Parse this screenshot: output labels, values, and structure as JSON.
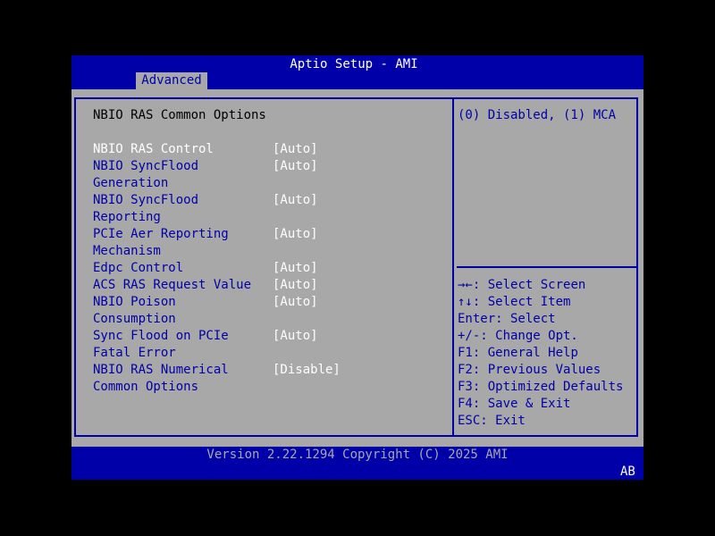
{
  "window": {
    "title": "Aptio Setup - AMI"
  },
  "tabs": [
    {
      "label": "Advanced",
      "selected": true
    }
  ],
  "section": {
    "title": "NBIO RAS Common Options"
  },
  "settings": [
    {
      "label_lines": [
        "NBIO RAS Control"
      ],
      "value": "[Auto]",
      "highlighted": true
    },
    {
      "label_lines": [
        "NBIO SyncFlood",
        "Generation"
      ],
      "value": "[Auto]",
      "highlighted": false
    },
    {
      "label_lines": [
        "NBIO SyncFlood",
        "Reporting"
      ],
      "value": "[Auto]",
      "highlighted": false
    },
    {
      "label_lines": [
        "PCIe Aer Reporting",
        "Mechanism"
      ],
      "value": "[Auto]",
      "highlighted": false
    },
    {
      "label_lines": [
        "Edpc Control"
      ],
      "value": "[Auto]",
      "highlighted": false
    },
    {
      "label_lines": [
        "ACS RAS Request Value"
      ],
      "value": "[Auto]",
      "highlighted": false
    },
    {
      "label_lines": [
        "NBIO Poison",
        "Consumption"
      ],
      "value": "[Auto]",
      "highlighted": false
    },
    {
      "label_lines": [
        "Sync Flood on PCIe",
        "Fatal Error"
      ],
      "value": "[Auto]",
      "highlighted": false
    },
    {
      "label_lines": [
        "NBIO RAS Numerical",
        "Common Options"
      ],
      "value": "[Disable]",
      "highlighted": false
    }
  ],
  "help": {
    "description": "(0) Disabled, (1) MCA"
  },
  "keys": [
    {
      "key": "→←:",
      "action": " Select Screen"
    },
    {
      "key": "↑↓:",
      "action": " Select Item"
    },
    {
      "key": "Enter:",
      "action": " Select"
    },
    {
      "key": "+/-:",
      "action": " Change Opt."
    },
    {
      "key": "F1:",
      "action": " General Help"
    },
    {
      "key": "F2:",
      "action": " Previous Values"
    },
    {
      "key": "F3:",
      "action": " Optimized Defaults"
    },
    {
      "key": "F4:",
      "action": " Save & Exit"
    },
    {
      "key": "ESC:",
      "action": " Exit"
    }
  ],
  "footer": {
    "version": "Version 2.22.1294 Copyright (C) 2025 AMI",
    "corner": "AB"
  },
  "colors": {
    "bios_blue": "#0000a8",
    "bios_gray": "#a8a8a8",
    "highlight_white": "#ffffff",
    "screen_black": "#000000"
  }
}
